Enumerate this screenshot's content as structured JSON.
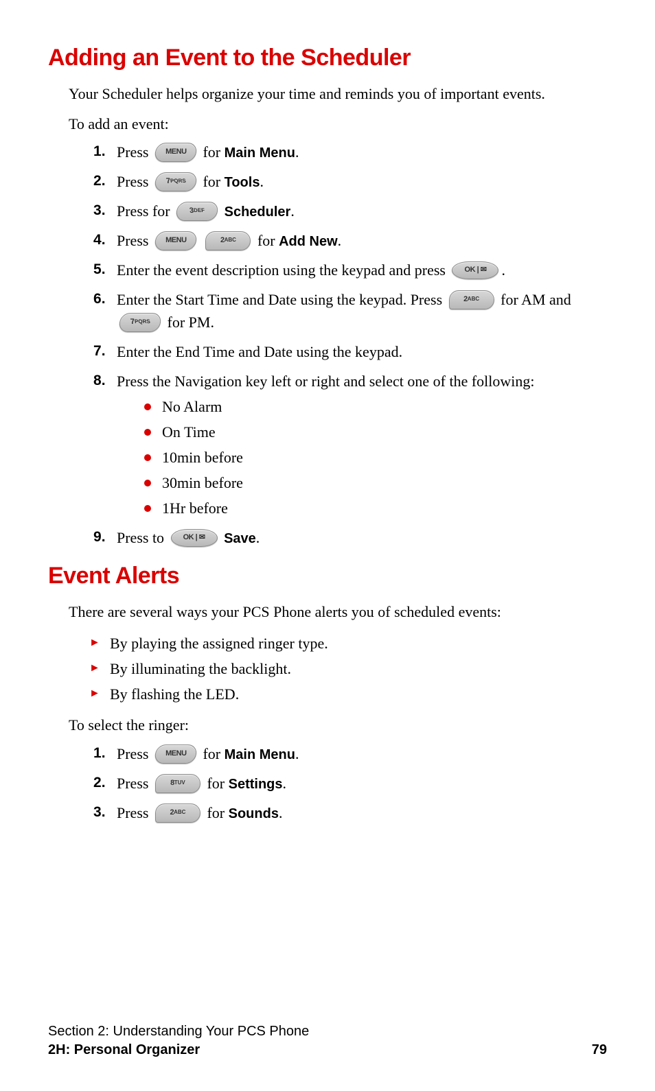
{
  "section1": {
    "title": "Adding an Event to the Scheduler",
    "intro": "Your Scheduler helps organize your time and reminds you of important events.",
    "lead": "To add an event:",
    "steps": {
      "s1": {
        "pre": "Press ",
        "key1": "MENU",
        "mid": " for ",
        "bold": "Main Menu",
        "end": "."
      },
      "s2": {
        "pre": "Press ",
        "key1": "7PQRS",
        "mid": " for ",
        "bold": "Tools",
        "end": "."
      },
      "s3": {
        "pre": "Press for ",
        "key1": "3DEF",
        "mid": " ",
        "bold": "Scheduler",
        "end": "."
      },
      "s4": {
        "pre": "Press ",
        "key1": "MENU",
        "key2": "2ABC",
        "mid": " for ",
        "bold": "Add New",
        "end": "."
      },
      "s5": {
        "pre": "Enter the event description using the keypad and press ",
        "key1": "OK | ✉",
        "end": "."
      },
      "s6": {
        "pre": "Enter the Start Time and Date using the keypad. Press ",
        "key1": "2ABC",
        "mid": " for AM and ",
        "key2": "7PQRS",
        "end": " for PM."
      },
      "s7": {
        "text": "Enter the End Time and Date using the keypad."
      },
      "s8": {
        "text": "Press the Navigation key left or right and select one of the following:"
      },
      "s9": {
        "pre": "Press to ",
        "key1": "OK | ✉",
        "mid": " ",
        "bold": "Save",
        "end": "."
      }
    },
    "options": [
      "No Alarm",
      "On Time",
      "10min before",
      "30min before",
      "1Hr before"
    ]
  },
  "section2": {
    "title": "Event Alerts",
    "intro": "There are several ways your PCS Phone alerts you of scheduled events:",
    "arrows": [
      "By playing the assigned ringer type.",
      "By illuminating the backlight.",
      "By flashing the LED."
    ],
    "lead": "To select the ringer:",
    "steps": {
      "s1": {
        "pre": "Press ",
        "key1": "MENU",
        "mid": " for ",
        "bold": "Main Menu",
        "end": "."
      },
      "s2": {
        "pre": "Press ",
        "key1": "8TUV",
        "mid": " for ",
        "bold": "Settings",
        "end": "."
      },
      "s3": {
        "pre": "Press ",
        "key1": "2ABC",
        "mid": " for ",
        "bold": "Sounds",
        "end": "."
      }
    }
  },
  "footer": {
    "line1": "Section 2: Understanding Your PCS Phone",
    "line2": "2H: Personal Organizer",
    "page": "79"
  },
  "keys": {
    "menu": "MENU",
    "7pqrs_main": "7",
    "7pqrs_sub": "PQRS",
    "3def_main": "3",
    "3def_sup": "DEF",
    "2abc_main": "2",
    "2abc_sub": "ABC",
    "8tuv_main": "8",
    "8tuv_sub": "TUV",
    "ok": "OK | ✉"
  }
}
